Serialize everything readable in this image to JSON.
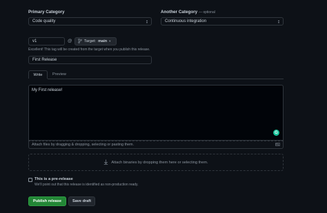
{
  "primary_category": {
    "label": "Primary Category",
    "selected": "Code quality"
  },
  "another_category": {
    "label": "Another Category",
    "optional_note": "— optional",
    "selected": "Continuous integration"
  },
  "tag": {
    "value": "v1",
    "at": "@",
    "target_prefix": "Target:",
    "target_branch": "main",
    "hint": "Excellent! This tag will be created from the target when you publish this release."
  },
  "release_title": {
    "value": "First Release"
  },
  "editor": {
    "tabs": [
      "Write",
      "Preview"
    ],
    "active_tab": "Write",
    "body": "My First release!",
    "attach_text": "Attach files by dragging & dropping, selecting or pasting them."
  },
  "binaries": {
    "text": "Attach binaries by dropping them here or selecting them."
  },
  "prerelease": {
    "label": "This is a pre-release",
    "hint": "We'll point out that this release is identified as non-production ready.",
    "checked": false
  },
  "actions": {
    "publish_label": "Publish release",
    "draft_label": "Save draft"
  },
  "colors": {
    "background": "#0d1117",
    "primary_button": "#238636",
    "border": "#30363d",
    "accent_icon": "#2ea043"
  },
  "icons": {
    "select_arrows": "updown-icon",
    "branch": "git-branch-icon",
    "dropdown": "caret-down-icon",
    "markdown": "markdown-icon",
    "grammarly": "grammarly-icon",
    "download": "arrow-down-icon"
  }
}
